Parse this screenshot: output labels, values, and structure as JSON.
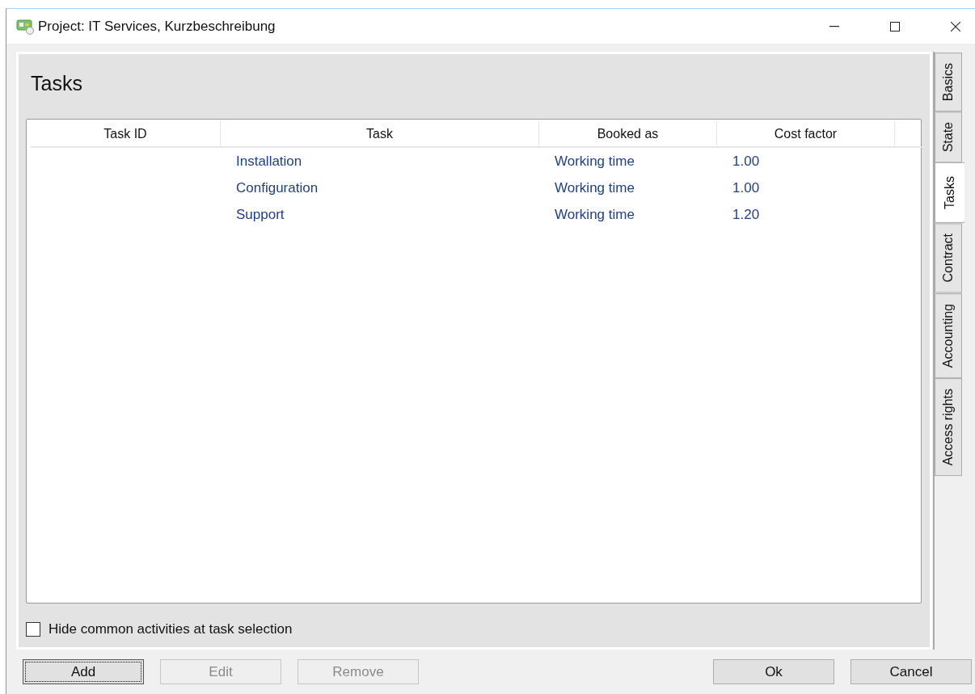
{
  "window": {
    "title": "Project: IT Services, Kurzbeschreibung"
  },
  "page": {
    "heading": "Tasks"
  },
  "table": {
    "columns": [
      "Task ID",
      "Task",
      "Booked as",
      "Cost factor"
    ],
    "rows": [
      {
        "cells": [
          "",
          "Installation",
          "Working time",
          "1.00"
        ]
      },
      {
        "cells": [
          "",
          "Configuration",
          "Working time",
          "1.00"
        ]
      },
      {
        "cells": [
          "",
          "Support",
          "Working time",
          "1.20"
        ]
      }
    ]
  },
  "option": {
    "label": "Hide common activities at task selection",
    "checked": false
  },
  "tabs": [
    {
      "label": "Basics",
      "selected": false
    },
    {
      "label": "State",
      "selected": false
    },
    {
      "label": "Tasks",
      "selected": true
    },
    {
      "label": "Contract",
      "selected": false
    },
    {
      "label": "Accounting",
      "selected": false
    },
    {
      "label": "Access rights",
      "selected": false
    }
  ],
  "buttons_left": [
    {
      "label": "Add",
      "disabled": false,
      "focused": true
    },
    {
      "label": "Edit",
      "disabled": true,
      "focused": false
    },
    {
      "label": "Remove",
      "disabled": true,
      "focused": false
    }
  ],
  "buttons_right": [
    {
      "label": "Ok",
      "disabled": false,
      "focused": false
    },
    {
      "label": "Cancel",
      "disabled": false,
      "focused": false
    }
  ]
}
